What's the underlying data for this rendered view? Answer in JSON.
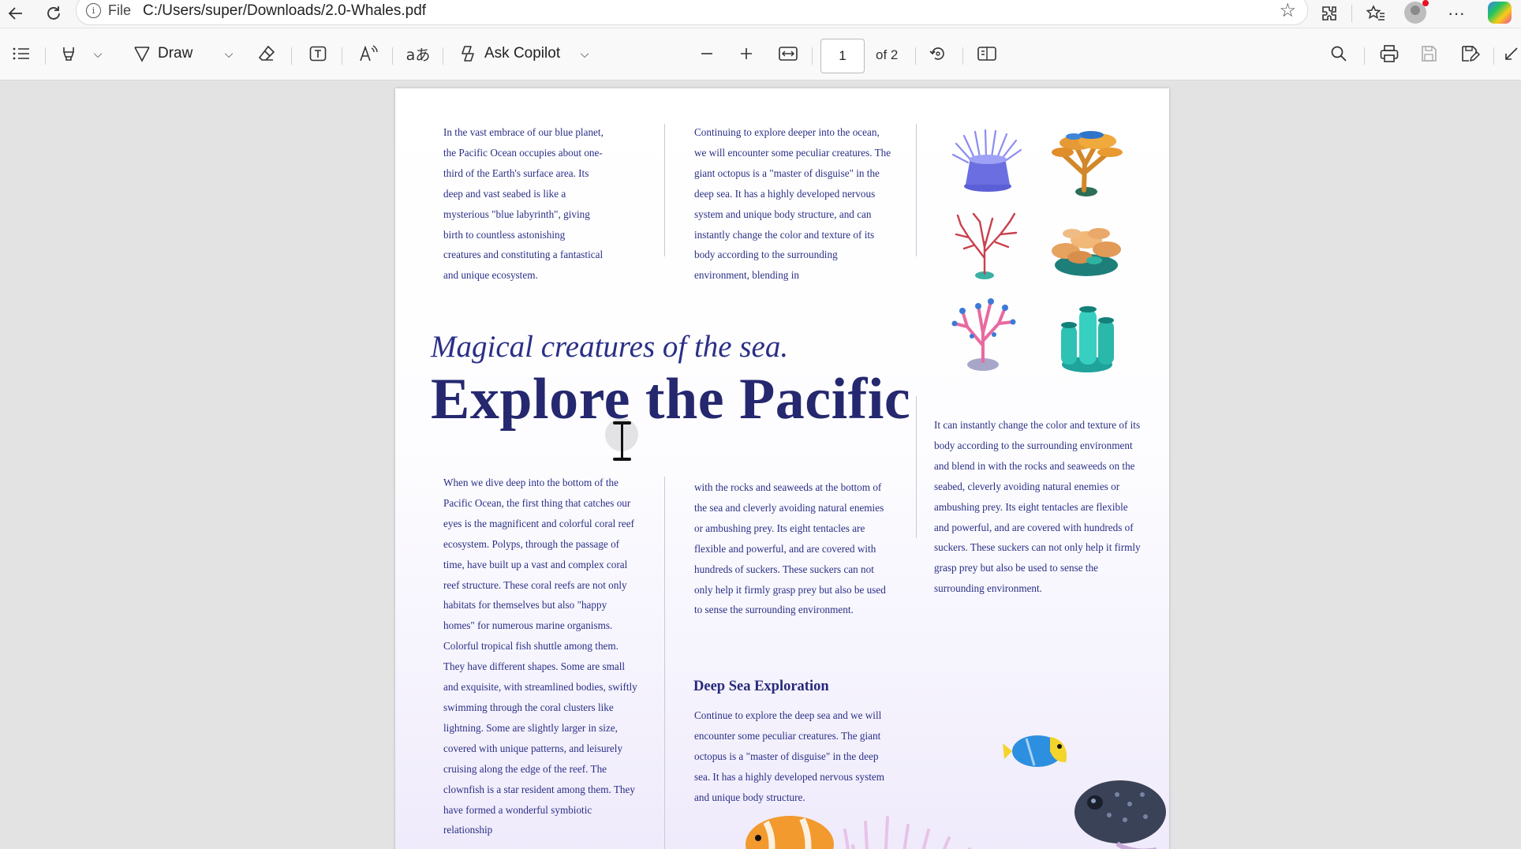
{
  "browser": {
    "file_label": "File",
    "url": "C:/Users/super/Downloads/2.0-Whales.pdf"
  },
  "toolbar": {
    "draw_label": "Draw",
    "copilot_label": "Ask Copilot",
    "page_number": "1",
    "page_total": "of 2"
  },
  "document": {
    "intro_col1": "In the vast embrace of our blue planet, the Pacific Ocean occupies about one-third of the Earth's surface area. Its deep and vast seabed is like a mysterious \"blue labyrinth\", giving birth to countless astonishing creatures and constituting a fantastical and unique ecosystem.",
    "intro_col2": "Continuing to explore deeper into the ocean, we will encounter some peculiar creatures. The giant octopus is a \"master of disguise\" in the deep sea. It has a highly developed nervous system and unique body structure, and can instantly change the color and texture of its body according to the surrounding environment, blending in",
    "subtitle": "Magical creatures of the sea.",
    "headline": "Explore the Pacific",
    "right_col": "It can instantly change the color and texture of its body according to the surrounding environment and blend in with the rocks and seaweeds on the seabed, cleverly avoiding natural enemies or ambushing prey. Its eight tentacles are flexible and powerful, and are covered with hundreds of suckers. These suckers can not only help it firmly grasp prey but also be used to sense the surrounding environment.",
    "body_col1": "When we dive deep into the bottom of the Pacific Ocean, the first thing that catches our eyes is the magnificent and colorful coral reef ecosystem. Polyps, through the passage of time, have built up a vast and complex coral reef structure. These coral reefs are not only habitats for themselves but also \"happy homes\" for numerous marine organisms. Colorful tropical fish shuttle among them. They have different shapes. Some are small and exquisite, with streamlined bodies, swiftly swimming through the coral clusters like lightning. Some are slightly larger in size, covered with unique patterns, and leisurely cruising along the edge of the reef. The clownfish is a star resident among them. They have formed a wonderful symbiotic relationship",
    "body_col2": "with the rocks and seaweeds at the bottom of the sea and cleverly avoiding natural enemies or ambushing prey. Its eight tentacles are flexible and powerful, and are covered with hundreds of suckers. These suckers can not only help it firmly grasp prey but also be used to sense the surrounding environment.",
    "section_heading": "Deep Sea Exploration",
    "section_text": "Continue to explore the deep sea and we will encounter some peculiar creatures. The giant octopus is a \"master of disguise\" in the deep sea. It has a highly developed nervous system and unique body structure."
  },
  "colors": {
    "text": "#2a2f85",
    "headline": "#25286f",
    "toolbar_bg": "#f9f9f9"
  }
}
